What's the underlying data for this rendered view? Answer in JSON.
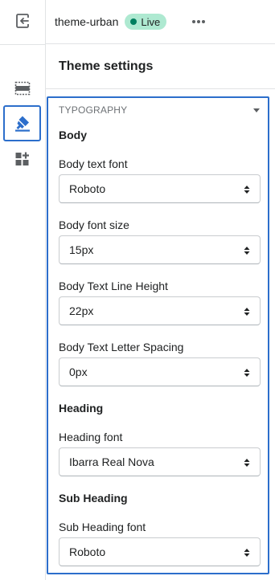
{
  "topbar": {
    "theme_name": "theme-urban",
    "status_badge": "Live"
  },
  "panel": {
    "title": "Theme settings"
  },
  "typography": {
    "section_label": "TYPOGRAPHY",
    "body": {
      "title": "Body",
      "text_font": {
        "label": "Body text font",
        "value": "Roboto"
      },
      "font_size": {
        "label": "Body font size",
        "value": "15px"
      },
      "line_height": {
        "label": "Body Text Line Height",
        "value": "22px"
      },
      "letter_spacing": {
        "label": "Body Text Letter Spacing",
        "value": "0px"
      }
    },
    "heading": {
      "title": "Heading",
      "font": {
        "label": "Heading font",
        "value": "Ibarra Real Nova"
      }
    },
    "sub_heading": {
      "title": "Sub Heading",
      "font": {
        "label": "Sub Heading font",
        "value": "Roboto"
      }
    }
  },
  "colors": {
    "accent": "#2c6ecb",
    "badge_bg": "#aee9d1",
    "badge_dot": "#007f5f",
    "border": "#e1e3e5"
  },
  "icons": [
    "exit-icon",
    "more-icon",
    "sections-icon",
    "theme-settings-icon",
    "apps-icon",
    "caret-down-icon",
    "select-arrows-icon"
  ]
}
